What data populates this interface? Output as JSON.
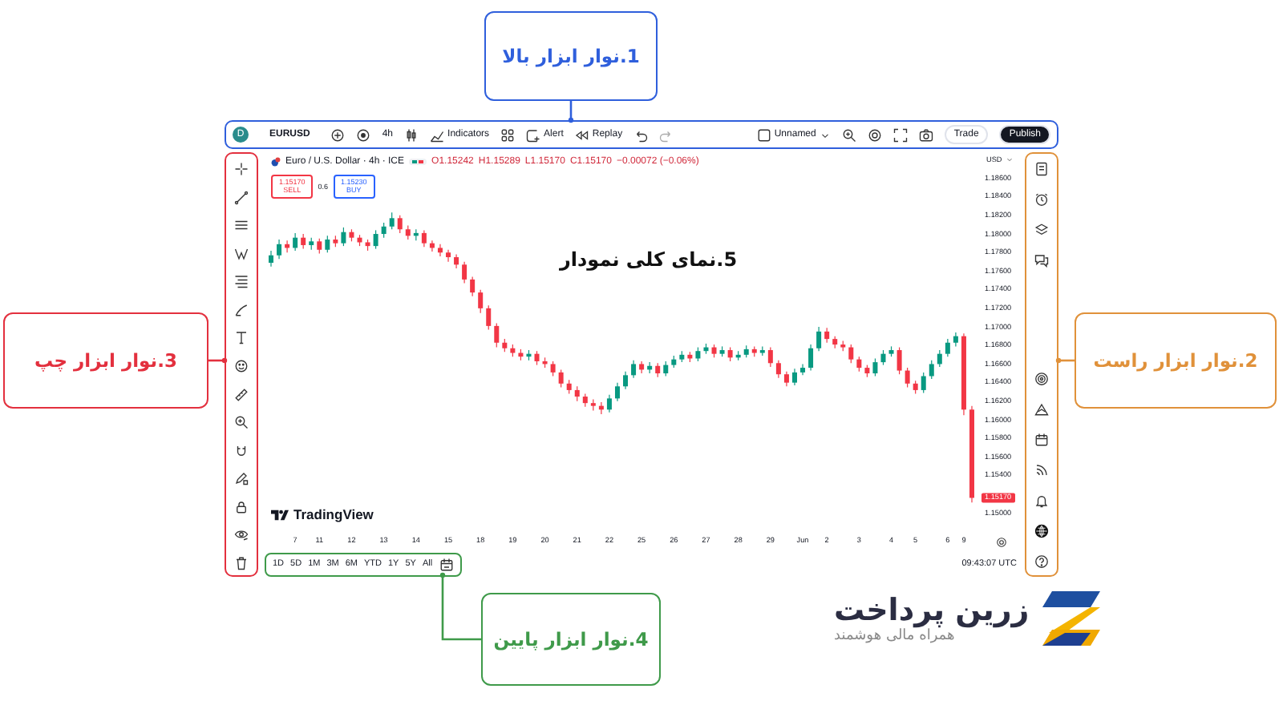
{
  "callouts": [
    {
      "label": "1.نوار ابزار بالا",
      "kind": "top",
      "color": "#2f5fdc"
    },
    {
      "label": "2.نوار ابزار راست",
      "kind": "right",
      "color": "#e0913a"
    },
    {
      "label": "3.نوار ابزار چپ",
      "kind": "left",
      "color": "#e3303e"
    },
    {
      "label": "4.نوار ابزار پایین",
      "kind": "bottom",
      "color": "#3f9a4a"
    }
  ],
  "top_toolbar": {
    "avatar": "D",
    "symbol": "EURUSD",
    "interval": "4h",
    "indicators": "Indicators",
    "alert": "Alert",
    "replay": "Replay",
    "layout_name": "Unnamed",
    "trade": "Trade",
    "publish": "Publish"
  },
  "legend": {
    "title": "Euro / U.S. Dollar · 4h · ICE",
    "values": [
      "O1.15242",
      "H1.15289",
      "L1.15170",
      "C1.15170",
      "−0.00072 (−0.06%)"
    ]
  },
  "trade": {
    "sell": {
      "price": "1.15170",
      "label": "SELL"
    },
    "spread": "0.6",
    "buy": {
      "price": "1.15230",
      "label": "BUY"
    }
  },
  "chart": {
    "chart_data": {
      "type": "candlestick",
      "ylim": [
        1.15,
        1.186
      ],
      "yticks": [
        {
          "value": 1.186,
          "label": "1.18600"
        },
        {
          "value": 1.184,
          "label": "1.18400"
        },
        {
          "value": 1.182,
          "label": "1.18200"
        },
        {
          "value": 1.18,
          "label": "1.18000"
        },
        {
          "value": 1.178,
          "label": "1.17800"
        },
        {
          "value": 1.176,
          "label": "1.17600"
        },
        {
          "value": 1.174,
          "label": "1.17400"
        },
        {
          "value": 1.172,
          "label": "1.17200"
        },
        {
          "value": 1.17,
          "label": "1.17000"
        },
        {
          "value": 1.168,
          "label": "1.16800"
        },
        {
          "value": 1.166,
          "label": "1.16600"
        },
        {
          "value": 1.164,
          "label": "1.16400"
        },
        {
          "value": 1.162,
          "label": "1.16200"
        },
        {
          "value": 1.16,
          "label": "1.16000"
        },
        {
          "value": 1.158,
          "label": "1.15800"
        },
        {
          "value": 1.156,
          "label": "1.15600"
        },
        {
          "value": 1.154,
          "label": "1.15400"
        },
        {
          "value": 1.15,
          "label": "1.15000"
        }
      ],
      "categories": [
        null,
        null,
        null,
        "7",
        null,
        null,
        "11",
        null,
        null,
        null,
        "12",
        null,
        null,
        null,
        "13",
        null,
        null,
        null,
        "14",
        null,
        null,
        null,
        "15",
        null,
        null,
        null,
        "18",
        null,
        null,
        null,
        "19",
        null,
        null,
        null,
        "20",
        null,
        null,
        null,
        "21",
        null,
        null,
        null,
        "22",
        null,
        null,
        null,
        "25",
        null,
        null,
        null,
        "26",
        null,
        null,
        null,
        "27",
        null,
        null,
        null,
        "28",
        null,
        null,
        null,
        "29",
        null,
        null,
        null,
        "Jun",
        null,
        null,
        "2",
        null,
        null,
        null,
        "3",
        null,
        null,
        null,
        "4",
        null,
        null,
        "5",
        null,
        null,
        null,
        "6",
        null,
        "9",
        null
      ],
      "ohlc": [
        [
          1.177,
          1.1783,
          1.1766,
          1.1778
        ],
        [
          1.1778,
          1.1795,
          1.1774,
          1.179
        ],
        [
          1.179,
          1.1794,
          1.1781,
          1.1786
        ],
        [
          1.1786,
          1.1802,
          1.1783,
          1.1797
        ],
        [
          1.1797,
          1.1801,
          1.1785,
          1.1789
        ],
        [
          1.1789,
          1.1797,
          1.1784,
          1.1793
        ],
        [
          1.1793,
          1.1796,
          1.178,
          1.1784
        ],
        [
          1.1784,
          1.1799,
          1.1781,
          1.1795
        ],
        [
          1.1795,
          1.1799,
          1.1787,
          1.1791
        ],
        [
          1.1791,
          1.1808,
          1.1788,
          1.1803
        ],
        [
          1.1803,
          1.1806,
          1.1793,
          1.1797
        ],
        [
          1.1797,
          1.18,
          1.1788,
          1.1792
        ],
        [
          1.1792,
          1.1795,
          1.1783,
          1.1788
        ],
        [
          1.1788,
          1.1805,
          1.1785,
          1.1801
        ],
        [
          1.1801,
          1.1813,
          1.1797,
          1.1809
        ],
        [
          1.1809,
          1.1824,
          1.1806,
          1.1818
        ],
        [
          1.1818,
          1.1821,
          1.1802,
          1.1806
        ],
        [
          1.1806,
          1.181,
          1.1795,
          1.1799
        ],
        [
          1.1799,
          1.1806,
          1.1794,
          1.1802
        ],
        [
          1.1802,
          1.1805,
          1.1787,
          1.1791
        ],
        [
          1.1791,
          1.1794,
          1.1782,
          1.1786
        ],
        [
          1.1786,
          1.179,
          1.1777,
          1.1781
        ],
        [
          1.1781,
          1.1784,
          1.1771,
          1.1776
        ],
        [
          1.1776,
          1.1779,
          1.1764,
          1.1768
        ],
        [
          1.1768,
          1.1771,
          1.1748,
          1.1752
        ],
        [
          1.1752,
          1.1755,
          1.1734,
          1.1738
        ],
        [
          1.1738,
          1.1741,
          1.1716,
          1.1721
        ],
        [
          1.1721,
          1.1724,
          1.1698,
          1.1702
        ],
        [
          1.1702,
          1.1705,
          1.1679,
          1.1684
        ],
        [
          1.1684,
          1.1688,
          1.1674,
          1.1678
        ],
        [
          1.1678,
          1.1682,
          1.1669,
          1.1673
        ],
        [
          1.1673,
          1.1677,
          1.1665,
          1.1669
        ],
        [
          1.1669,
          1.1676,
          1.1665,
          1.1672
        ],
        [
          1.1672,
          1.1675,
          1.166,
          1.1664
        ],
        [
          1.1664,
          1.1668,
          1.1657,
          1.1661
        ],
        [
          1.1661,
          1.1664,
          1.1648,
          1.1652
        ],
        [
          1.1652,
          1.1655,
          1.1636,
          1.164
        ],
        [
          1.164,
          1.1644,
          1.1629,
          1.1633
        ],
        [
          1.1633,
          1.1637,
          1.1621,
          1.1626
        ],
        [
          1.1626,
          1.1629,
          1.1615,
          1.1619
        ],
        [
          1.1619,
          1.1623,
          1.1611,
          1.1616
        ],
        [
          1.1616,
          1.162,
          1.1607,
          1.1612
        ],
        [
          1.1612,
          1.1628,
          1.1609,
          1.1624
        ],
        [
          1.1624,
          1.1641,
          1.1621,
          1.1637
        ],
        [
          1.1637,
          1.1653,
          1.1634,
          1.1649
        ],
        [
          1.1649,
          1.1665,
          1.1646,
          1.1661
        ],
        [
          1.1661,
          1.1664,
          1.1651,
          1.1655
        ],
        [
          1.1655,
          1.1663,
          1.1651,
          1.1659
        ],
        [
          1.1659,
          1.1662,
          1.1647,
          1.1651
        ],
        [
          1.1651,
          1.1664,
          1.1648,
          1.166
        ],
        [
          1.166,
          1.167,
          1.1657,
          1.1666
        ],
        [
          1.1666,
          1.1675,
          1.1663,
          1.1671
        ],
        [
          1.1671,
          1.1674,
          1.1663,
          1.1667
        ],
        [
          1.1667,
          1.1679,
          1.1664,
          1.1675
        ],
        [
          1.1675,
          1.1683,
          1.1672,
          1.1679
        ],
        [
          1.1679,
          1.1682,
          1.1668,
          1.1672
        ],
        [
          1.1672,
          1.168,
          1.1669,
          1.1676
        ],
        [
          1.1676,
          1.1679,
          1.1664,
          1.1668
        ],
        [
          1.1668,
          1.1675,
          1.1665,
          1.1671
        ],
        [
          1.1671,
          1.1681,
          1.1668,
          1.1677
        ],
        [
          1.1677,
          1.168,
          1.1669,
          1.1673
        ],
        [
          1.1673,
          1.168,
          1.167,
          1.1676
        ],
        [
          1.1676,
          1.1679,
          1.1658,
          1.1662
        ],
        [
          1.1662,
          1.1665,
          1.1646,
          1.165
        ],
        [
          1.165,
          1.1653,
          1.1637,
          1.1641
        ],
        [
          1.1641,
          1.1656,
          1.1638,
          1.1652
        ],
        [
          1.1652,
          1.1661,
          1.1649,
          1.1657
        ],
        [
          1.1657,
          1.1682,
          1.1654,
          1.1678
        ],
        [
          1.1678,
          1.1701,
          1.1675,
          1.1696
        ],
        [
          1.1696,
          1.17,
          1.1684,
          1.1688
        ],
        [
          1.1688,
          1.1691,
          1.1678,
          1.1682
        ],
        [
          1.1682,
          1.1686,
          1.1675,
          1.1679
        ],
        [
          1.1679,
          1.1682,
          1.1662,
          1.1666
        ],
        [
          1.1666,
          1.1669,
          1.1653,
          1.1657
        ],
        [
          1.1657,
          1.166,
          1.1647,
          1.1651
        ],
        [
          1.1651,
          1.1667,
          1.1648,
          1.1663
        ],
        [
          1.1663,
          1.1676,
          1.166,
          1.1672
        ],
        [
          1.1672,
          1.168,
          1.1669,
          1.1676
        ],
        [
          1.1676,
          1.1679,
          1.165,
          1.1654
        ],
        [
          1.1654,
          1.1657,
          1.1636,
          1.164
        ],
        [
          1.164,
          1.1643,
          1.1629,
          1.1633
        ],
        [
          1.1633,
          1.1652,
          1.163,
          1.1648
        ],
        [
          1.1648,
          1.1665,
          1.1645,
          1.1661
        ],
        [
          1.1661,
          1.1676,
          1.1658,
          1.1672
        ],
        [
          1.1672,
          1.1688,
          1.1669,
          1.1684
        ],
        [
          1.1684,
          1.1695,
          1.168,
          1.1691
        ],
        [
          1.1691,
          1.1694,
          1.1606,
          1.1612
        ],
        [
          1.1612,
          1.1616,
          1.1512,
          1.1517
        ]
      ]
    }
  },
  "chart_label": "5.نمای کلی نمودار",
  "watermark_logo": "TradingView",
  "price_axis": {
    "currency": "USD",
    "last_price": "1.15170"
  },
  "ranges": [
    "1D",
    "5D",
    "1M",
    "3M",
    "6M",
    "YTD",
    "1Y",
    "5Y",
    "All"
  ],
  "clock": "09:43:07 UTC",
  "brand": {
    "name": "زرین پرداخت",
    "tagline": "همراه مالی هوشمند"
  }
}
